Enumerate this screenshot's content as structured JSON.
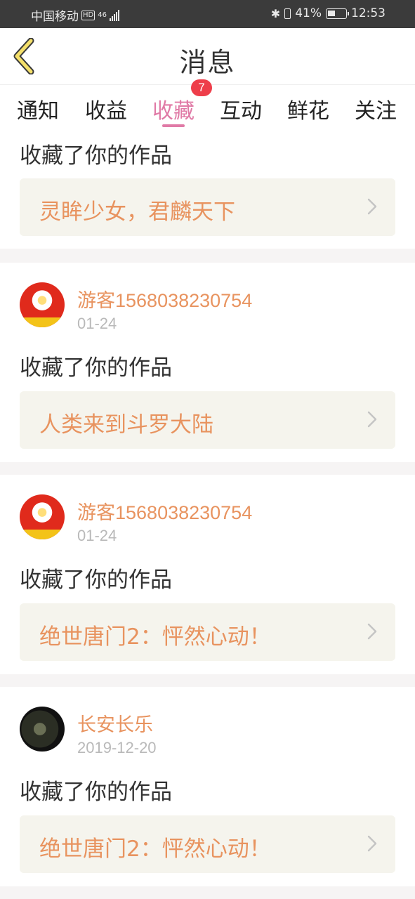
{
  "status_bar": {
    "carrier": "中国移动",
    "network_badge": "HD",
    "network_type": "46",
    "battery_percent": "41%",
    "time": "12:53"
  },
  "header": {
    "title": "消息",
    "back_icon": "chevron-left-icon"
  },
  "tabs": {
    "items": [
      "通知",
      "收益",
      "收藏",
      "互动",
      "鲜花",
      "关注"
    ],
    "active": "收藏",
    "badge": "7"
  },
  "colors": {
    "accent_pink": "#e07aa6",
    "username_orange": "#e8935f",
    "badge_red": "#ee3e4a",
    "work_box_bg": "#f5f4ed"
  },
  "messages": [
    {
      "user": "",
      "date": "",
      "action": "收藏了你的作品",
      "work": "灵眸少女，君麟天下"
    },
    {
      "user": "游客1568038230754",
      "date": "01-24",
      "action": "收藏了你的作品",
      "work": "人类来到斗罗大陆"
    },
    {
      "user": "游客1568038230754",
      "date": "01-24",
      "action": "收藏了你的作品",
      "work": "绝世唐门2：怦然心动！"
    },
    {
      "user": "长安长乐",
      "date": "2019-12-20",
      "action": "收藏了你的作品",
      "work": "绝世唐门2：怦然心动！"
    }
  ]
}
